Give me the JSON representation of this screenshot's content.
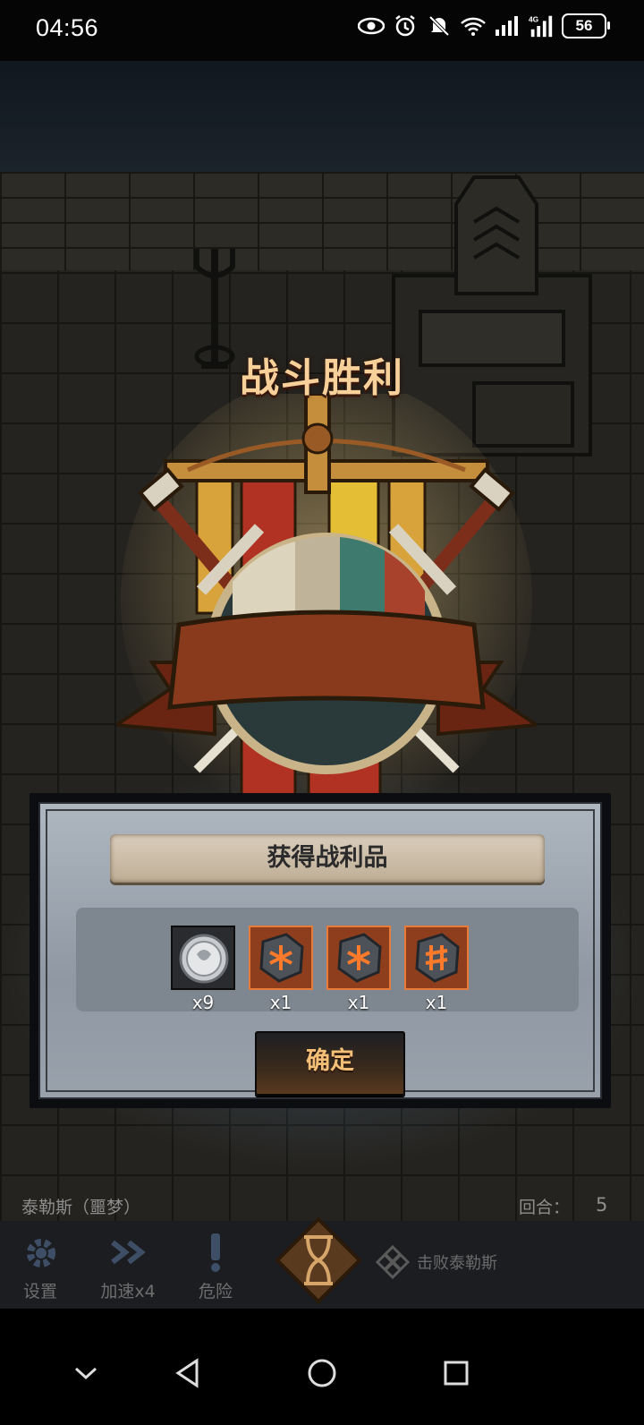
{
  "status_bar": {
    "time": "04:56",
    "battery": "56",
    "icons": [
      "eye-icon",
      "alarm-icon",
      "mute-icon",
      "wifi-icon",
      "signal-icon",
      "4g-signal-icon",
      "battery-icon"
    ]
  },
  "battle": {
    "title": "战斗胜利"
  },
  "rewards": {
    "heading": "获得战利品",
    "items": [
      {
        "icon": "silver-coin-icon",
        "count": "x9"
      },
      {
        "icon": "rune-stone-icon",
        "count": "x1"
      },
      {
        "icon": "rune-stone-icon",
        "count": "x1"
      },
      {
        "icon": "rune-stone-icon",
        "count": "x1"
      }
    ],
    "confirm_label": "确定"
  },
  "hud": {
    "boss_name": "泰勒斯（噩梦）",
    "round_label": "回合：",
    "round_value": "5",
    "buttons": [
      {
        "label": "设置",
        "icon": "gear-icon"
      },
      {
        "label": "加速x4",
        "icon": "fast-forward-icon"
      },
      {
        "label": "危险",
        "icon": "exclamation-icon"
      }
    ],
    "objective": "击败泰勒斯",
    "colors": {
      "accent": "#e97b3a",
      "title": "#f7d09a",
      "banner": "#8a3a1c"
    }
  },
  "nav": {
    "icons": [
      "chevron-down-icon",
      "back-triangle-icon",
      "home-circle-icon",
      "recents-square-icon"
    ]
  }
}
